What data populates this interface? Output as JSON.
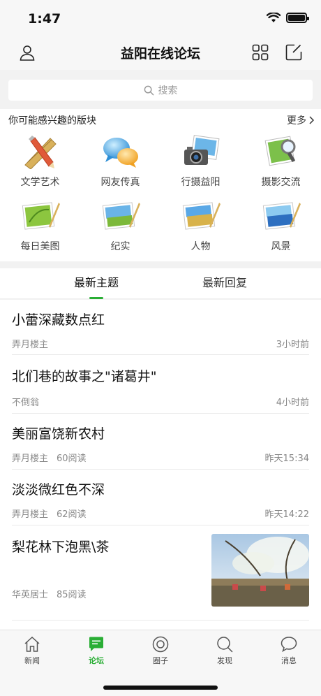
{
  "status": {
    "time": "1:47"
  },
  "navbar": {
    "title": "益阳在线论坛",
    "left_icon": "user-icon",
    "right_icons": [
      "grid-icon",
      "edit-icon"
    ]
  },
  "search": {
    "placeholder": "搜索"
  },
  "interest": {
    "title": "你可能感兴趣的版块",
    "more": "更多",
    "items": [
      {
        "label": "文学艺术",
        "icon": "pencil-ruler-icon"
      },
      {
        "label": "网友传真",
        "icon": "chat-bubbles-icon"
      },
      {
        "label": "行摄益阳",
        "icon": "camera-photo-icon"
      },
      {
        "label": "摄影交流",
        "icon": "magnifier-photo-icon"
      },
      {
        "label": "每日美图",
        "icon": "picture-leaf-icon"
      },
      {
        "label": "纪实",
        "icon": "picture-landscape-icon"
      },
      {
        "label": "人物",
        "icon": "picture-field-icon"
      },
      {
        "label": "风景",
        "icon": "picture-sea-icon"
      }
    ]
  },
  "tabs": {
    "latest_topics": "最新主题",
    "latest_replies": "最新回复",
    "active": "latest_topics"
  },
  "posts": [
    {
      "title": "小蕾深藏数点红",
      "author": "弄月楼主",
      "reads": "",
      "time": "3小时前"
    },
    {
      "title": "北们巷的故事之\"诸葛井\"",
      "author": "不倒翁",
      "reads": "",
      "time": "4小时前"
    },
    {
      "title": "美丽富饶新农村",
      "author": "弄月楼主",
      "reads": "60阅读",
      "time": "昨天15:34"
    },
    {
      "title": "淡淡微红色不深",
      "author": "弄月楼主",
      "reads": "62阅读",
      "time": "昨天14:22"
    },
    {
      "title": "梨花林下泡黑\\茶",
      "author": "华英居士",
      "reads": "85阅读",
      "time": ""
    }
  ],
  "tabbar": {
    "items": [
      {
        "label": "新闻",
        "icon": "house-icon"
      },
      {
        "label": "论坛",
        "icon": "message-square-icon"
      },
      {
        "label": "圈子",
        "icon": "circle-target-icon"
      },
      {
        "label": "发现",
        "icon": "search-icon"
      },
      {
        "label": "消息",
        "icon": "chat-bubble-icon"
      }
    ],
    "active": "论坛"
  },
  "colors": {
    "accent": "#2aae35",
    "text": "#111111",
    "muted": "#888888",
    "background": "#f2f2f2"
  }
}
